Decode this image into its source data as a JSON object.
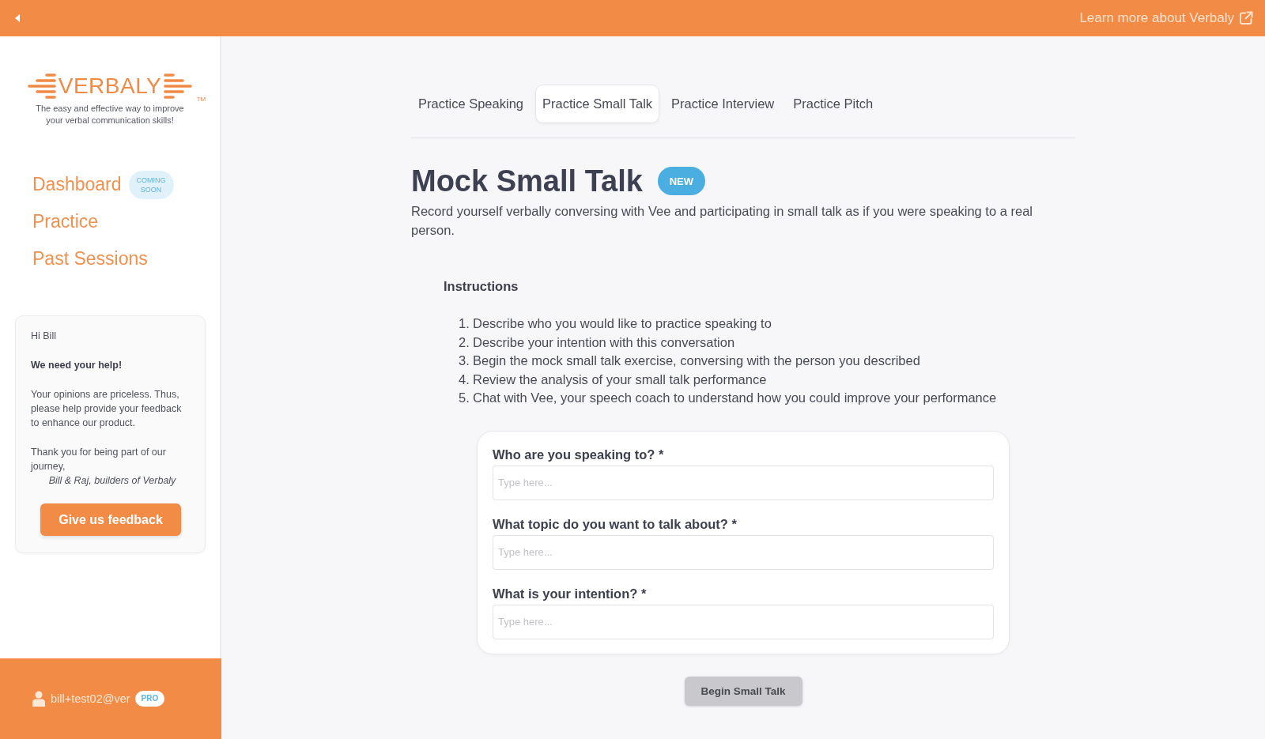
{
  "top_bar": {
    "link": "Learn more about Verbaly"
  },
  "sidebar": {
    "logo": {
      "wordmark": "VERBALY",
      "trademark": "TM"
    },
    "tagline": "The easy and effective way to improve your verbal communication skills!",
    "nav": [
      {
        "label": "Dashboard",
        "badge": "COMING SOON"
      },
      {
        "label": "Practice"
      },
      {
        "label": "Past Sessions"
      }
    ],
    "feedback_card": {
      "greeting": "Hi Bill",
      "heading": "We need your help!",
      "body": "Your opinions are priceless. Thus, please help provide your feedback to enhance our product.",
      "thanks": "Thank you for being part of our journey,",
      "signature": "Bill & Raj, builders of Verbaly",
      "button": "Give us feedback"
    },
    "user": {
      "email": "bill+test02@ver",
      "plan": "PRO"
    }
  },
  "tabs": [
    {
      "label": "Practice Speaking",
      "selected": false
    },
    {
      "label": "Practice Small Talk",
      "selected": true
    },
    {
      "label": "Practice Interview",
      "selected": false
    },
    {
      "label": "Practice Pitch",
      "selected": false
    }
  ],
  "header": {
    "title": "Mock Small Talk",
    "badge": "NEW",
    "description": "Record yourself verbally conversing with Vee and participating in small talk as if you were speaking to a real person."
  },
  "instructions": {
    "heading": "Instructions",
    "steps": [
      {
        "number": "1.",
        "text": "Describe who you would like to practice speaking to"
      },
      {
        "number": "2.",
        "text": "Describe your intention with this conversation"
      },
      {
        "number": "3.",
        "text": "Begin the mock small talk exercise, conversing with the person you described"
      },
      {
        "number": "4.",
        "text": "Review the analysis of your small talk performance"
      },
      {
        "number": "5.",
        "text": "Chat with Vee, your speech coach to understand how you could improve your performance"
      }
    ]
  },
  "form": {
    "fields": [
      {
        "label": "Who are you speaking to? *",
        "placeholder": "Type here..."
      },
      {
        "label": "What topic do you want to talk about? *",
        "placeholder": "Type here..."
      },
      {
        "label": "What is your intention? *",
        "placeholder": "Type here..."
      }
    ]
  },
  "submit_button": {
    "label": "Begin Small Talk",
    "disabled": true
  }
}
